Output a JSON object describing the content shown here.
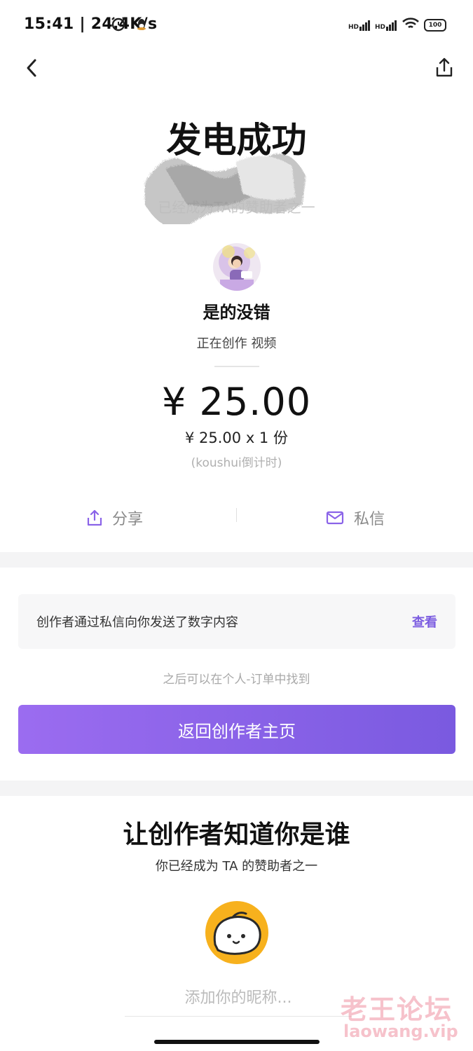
{
  "status_bar": {
    "time_speed": "15:41 | 24.4K/s",
    "signal1": "HD",
    "signal2": "HD",
    "battery": "100"
  },
  "header": {
    "back_icon": "chevron-left-icon",
    "share_icon": "share-upload-icon"
  },
  "result": {
    "title": "发电成功",
    "subtitle": "已经成为TA的赞助者之一"
  },
  "creator": {
    "name": "是的没错",
    "status": "正在创作 视频"
  },
  "payment": {
    "amount": "¥ 25.00",
    "unit_line": "¥ 25.00 x 1 份",
    "countdown": "(koushui倒计时)"
  },
  "actions": {
    "share_label": "分享",
    "message_label": "私信"
  },
  "notice": {
    "text": "创作者通过私信向你发送了数字内容",
    "link": "查看",
    "hint": "之后可以在个人-订单中找到",
    "button": "返回创作者主页"
  },
  "identity": {
    "title": "让创作者知道你是谁",
    "subtitle": "你已经成为 TA 的赞助者之一",
    "nickname_placeholder": "添加你的昵称..."
  },
  "watermark": {
    "cn": "老王论坛",
    "en": "laowang.vip"
  },
  "colors": {
    "accent": "#8a63e8",
    "mascot": "#f7b11d"
  }
}
